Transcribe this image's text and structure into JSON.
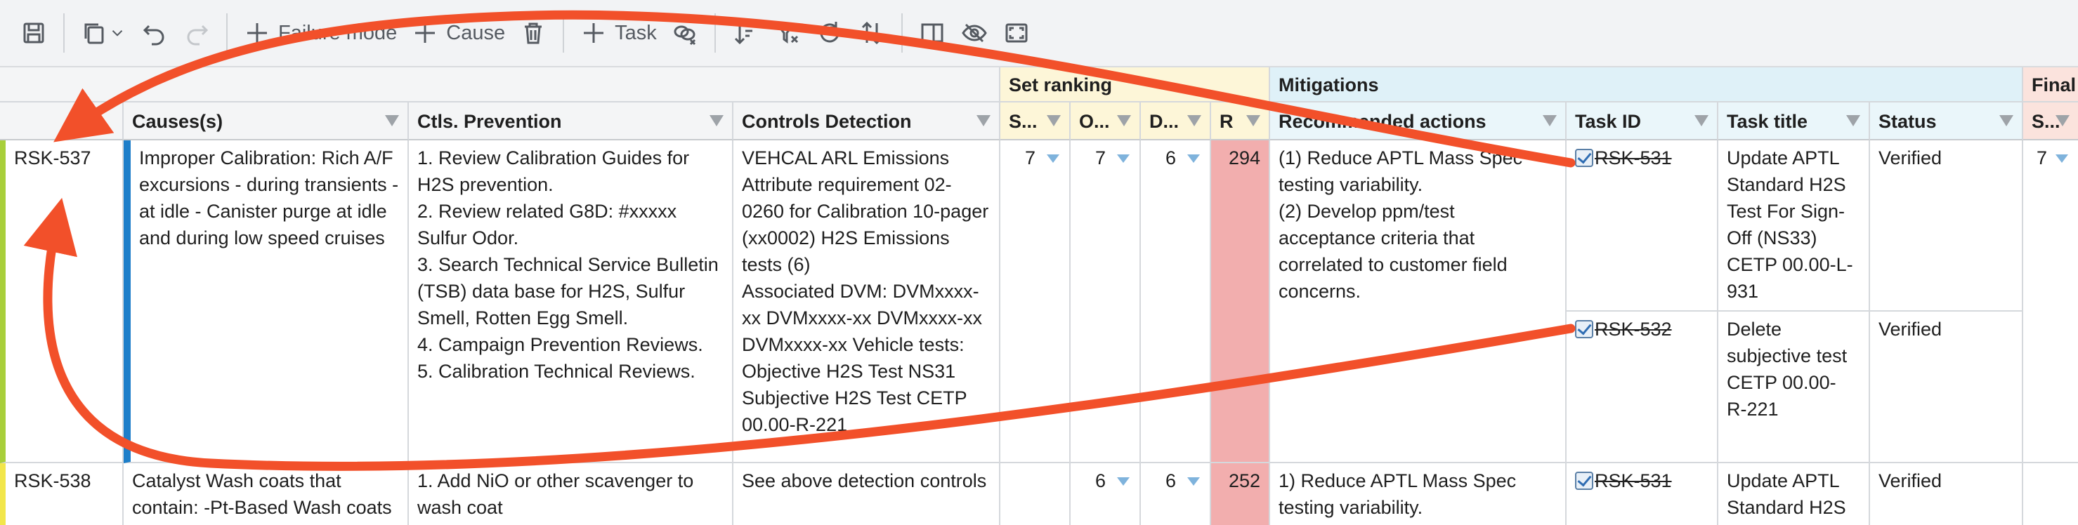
{
  "toolbar": {
    "failure_mode_label": "Failure mode",
    "cause_label": "Cause",
    "task_label": "Task"
  },
  "groups": {
    "set_ranking": "Set ranking",
    "mitigations": "Mitigations",
    "final": "Final"
  },
  "headers": {
    "causes": "Causes(s)",
    "ctls_prevention": "Ctls. Prevention",
    "controls_detection": "Controls Detection",
    "s": "S...",
    "o": "O...",
    "d": "D...",
    "r": "R",
    "recommended_actions": "Recommended actions",
    "task_id": "Task ID",
    "task_title": "Task title",
    "status": "Status",
    "final_s": "S..."
  },
  "rows": [
    {
      "id": "RSK-537",
      "cause": "Improper Calibration: Rich A/F excursions - during transients - at idle - Canister purge at idle and during low speed cruises",
      "prevention": [
        "1. Review Calibration Guides for H2S prevention.",
        "2. Review related G8D: #xxxxx Sulfur Odor.",
        "3. Search Technical Service Bulletin (TSB) data base for H2S, Sulfur Smell, Rotten Egg Smell.",
        "4. Campaign Prevention Reviews.",
        "5. Calibration Technical Reviews."
      ],
      "detection": [
        "VEHCAL ARL Emissions Attribute requirement 02-0260 for Calibration 10-pager (xx0002) H2S Emissions tests (6)",
        "Associated DVM: DVMxxxx-xx DVMxxxx-xx DVMxxxx-xx DVMxxxx-xx Vehicle tests: Objective H2S Test NS31",
        "Subjective H2S Test CETP 00.00-R-221"
      ],
      "s": "7",
      "o": "7",
      "d": "6",
      "r": "294",
      "actions": [
        "(1) Reduce APTL Mass Spec testing variability.",
        "(2) Develop ppm/test acceptance criteria that correlated to customer field concerns."
      ],
      "tasks": [
        {
          "task_id": "RSK-531",
          "title": "Update APTL Standard H2S Test For Sign-Off (NS33) CETP 00.00-L-931",
          "status": "Verified"
        },
        {
          "task_id": "RSK-532",
          "title": "Delete subjective test CETP 00.00- R-221",
          "status": "Verified"
        }
      ],
      "final_s": "7"
    },
    {
      "id": "RSK-538",
      "cause": "Catalyst Wash coats that contain: -Pt-Based Wash coats",
      "prevention": [
        "1. Add NiO or other scavenger to wash coat"
      ],
      "detection": [
        "See above detection controls"
      ],
      "s": "",
      "o": "6",
      "d": "6",
      "r": "252",
      "actions": [
        "1) Reduce APTL Mass Spec testing variability."
      ],
      "tasks": [
        {
          "task_id": "RSK-531",
          "title": "Update APTL Standard H2S",
          "status": "Verified"
        }
      ],
      "final_s": ""
    }
  ],
  "colors": {
    "set_ranking_bg": "#fdf6d8",
    "mitigations_bg": "#dff1f8",
    "final_bg": "#fbe3dd",
    "r_cell": "#f2aeae",
    "row1_marker": "#a8cf3a",
    "row2_marker": "#f2e64b",
    "cause_marker": "#1d7ec9",
    "annotation": "#f2502a"
  }
}
